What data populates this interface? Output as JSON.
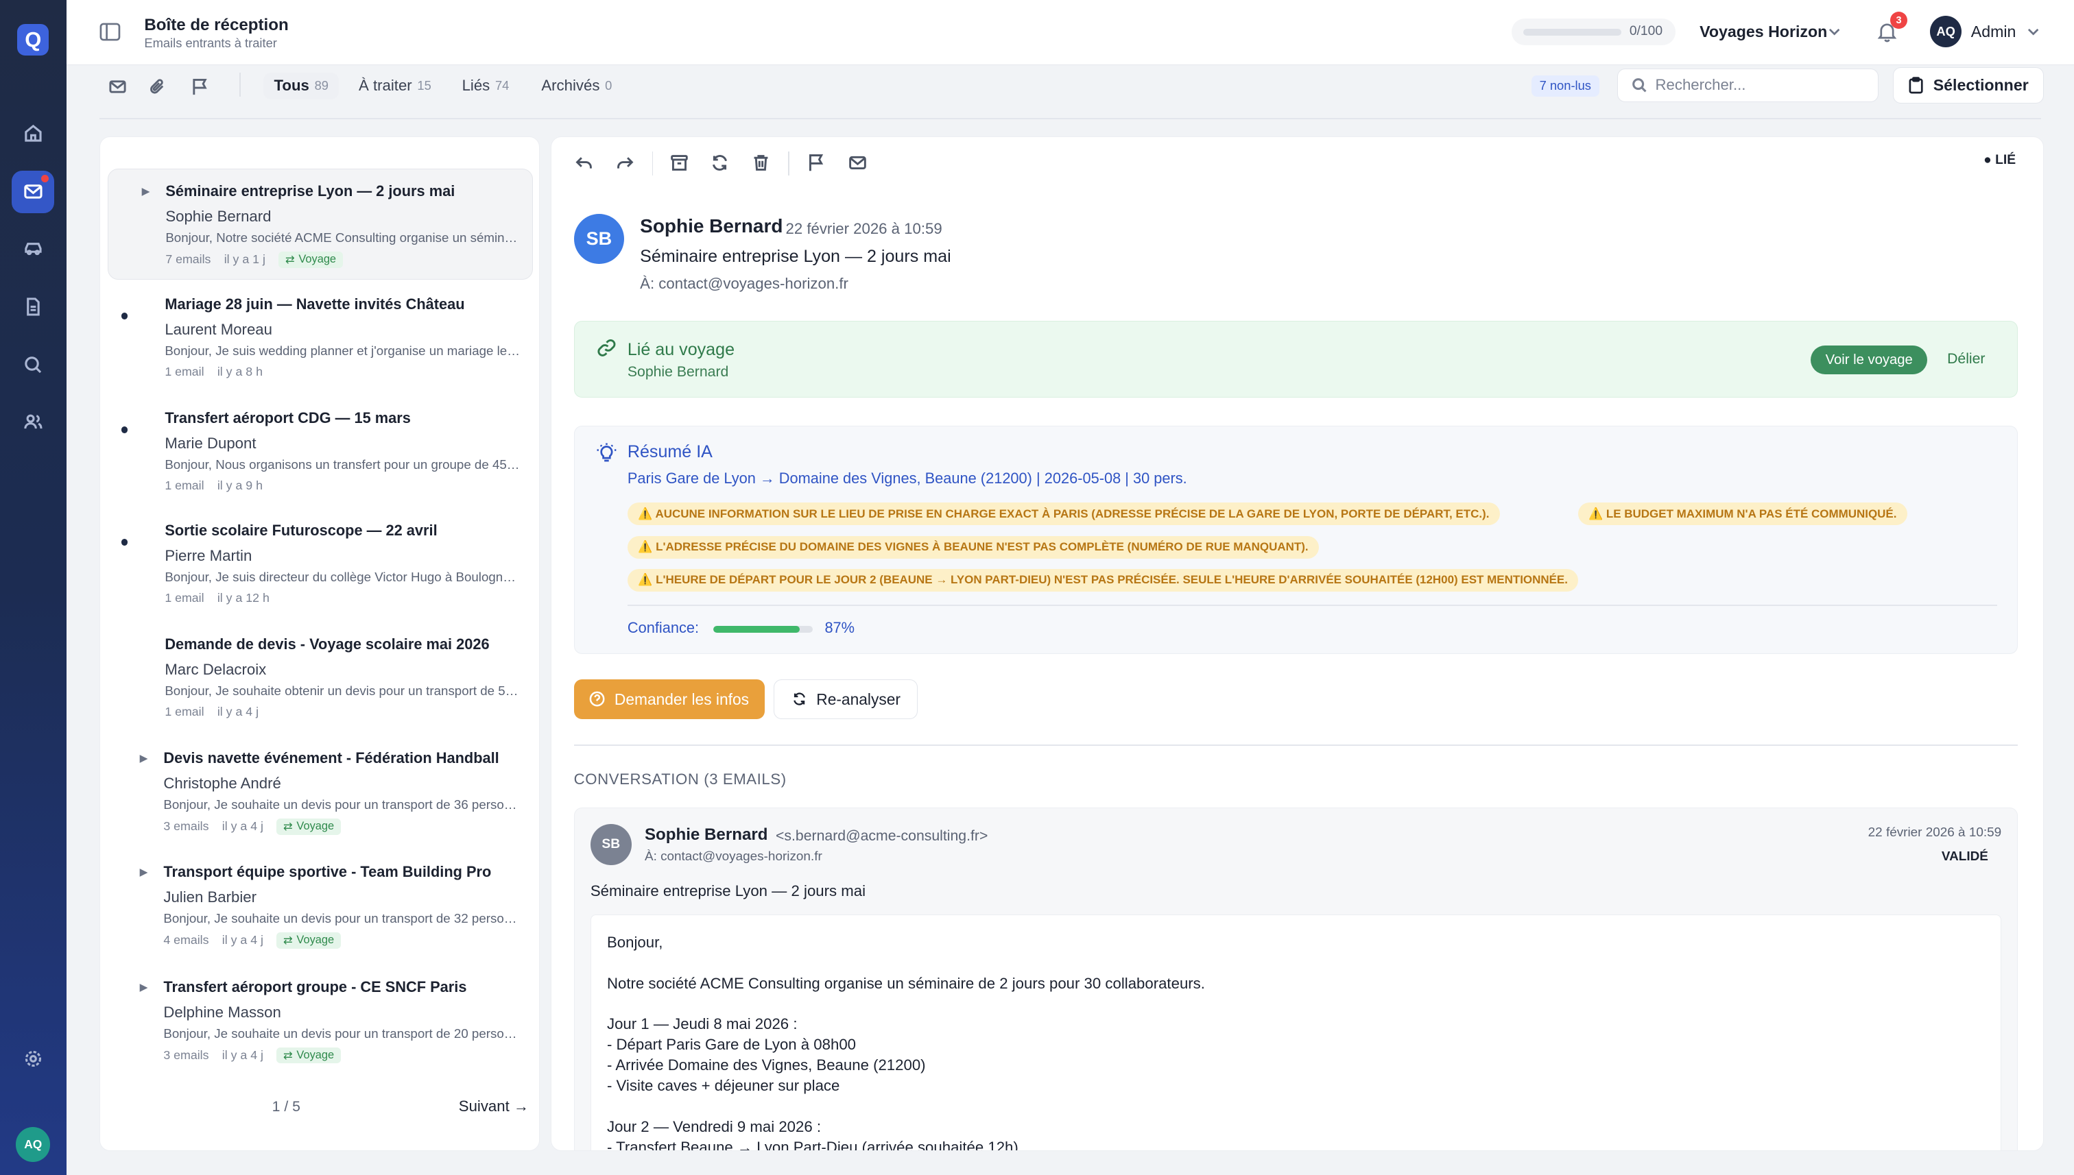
{
  "app": {
    "logo": "Q",
    "header_title": "Boîte de réception",
    "header_subtitle": "Emails entrants à traiter",
    "quota_text": "0/100",
    "company": "Voyages Horizon",
    "notif_count": "3",
    "user_initials": "AQ",
    "user_name": "Admin",
    "sidebar_user_initials": "AQ"
  },
  "filters": {
    "tabs": [
      {
        "label": "Tous",
        "count": "89"
      },
      {
        "label": "À traiter",
        "count": "15"
      },
      {
        "label": "Liés",
        "count": "74"
      },
      {
        "label": "Archivés",
        "count": "0"
      }
    ],
    "unread": "7 non-lus",
    "search_placeholder": "Rechercher...",
    "select_label": "Sélectionner"
  },
  "emails": [
    {
      "subject": "Séminaire entreprise Lyon — 2 jours mai",
      "from": "Sophie Bernard",
      "preview": "Bonjour, Notre société ACME Consulting organise un séminaire de 2 jours pour 30 collaborateurs.",
      "count": "7 emails",
      "time": "il y a 1 j",
      "tag": "Voyage"
    },
    {
      "subject": "Mariage 28 juin — Navette invités Château",
      "from": "Laurent Moreau",
      "preview": "Bonjour, Je suis wedding planner et j'organise un mariage le 28 juin.",
      "count": "1 email",
      "time": "il y a 8 h",
      "tag": ""
    },
    {
      "subject": "Transfert aéroport CDG — 15 mars",
      "from": "Marie Dupont",
      "preview": "Bonjour, Nous organisons un transfert pour un groupe de 45 personnes.",
      "count": "1 email",
      "time": "il y a 9 h",
      "tag": ""
    },
    {
      "subject": "Sortie scolaire Futuroscope — 22 avril",
      "from": "Pierre Martin",
      "preview": "Bonjour, Je suis directeur du collège Victor Hugo à Boulogne-Billancourt.",
      "count": "1 email",
      "time": "il y a 12 h",
      "tag": ""
    },
    {
      "subject": "Demande de devis - Voyage scolaire mai 2026",
      "from": "Marc Delacroix",
      "preview": "Bonjour, Je souhaite obtenir un devis pour un transport de 50 élèves.",
      "count": "1 email",
      "time": "il y a 4 j",
      "tag": ""
    },
    {
      "subject": "Devis navette événement - Fédération Handball",
      "from": "Christophe André",
      "preview": "Bonjour, Je souhaite un devis pour un transport de 36 personnes.",
      "count": "3 emails",
      "time": "il y a 4 j",
      "tag": "Voyage"
    },
    {
      "subject": "Transport équipe sportive - Team Building Pro",
      "from": "Julien Barbier",
      "preview": "Bonjour, Je souhaite un devis pour un transport de 32 personnes.",
      "count": "4 emails",
      "time": "il y a 4 j",
      "tag": "Voyage"
    },
    {
      "subject": "Transfert aéroport groupe - CE SNCF Paris",
      "from": "Delphine Masson",
      "preview": "Bonjour, Je souhaite un devis pour un transport de 20 personnes.",
      "count": "3 emails",
      "time": "il y a 4 j",
      "tag": "Voyage"
    }
  ],
  "pagination": {
    "page": "1 / 5",
    "next": "Suivant →"
  },
  "detail": {
    "status_badge": "● LIÉ",
    "avatar": "SB",
    "sender": "Sophie Bernard",
    "date": "22 février 2026 à 10:59",
    "subject": "Séminaire entreprise Lyon — 2 jours mai",
    "to": "À: contact@voyages-horizon.fr",
    "linked_title": "Lié au voyage",
    "linked_name": "Sophie Bernard",
    "view_trip": "Voir le voyage",
    "unlink": "Délier",
    "summary_title": "Résumé IA",
    "summary_line": "Paris Gare de Lyon → Domaine des Vignes, Beaune (21200) | 2026-05-08 | 30 pers.",
    "warnings": [
      "⚠️ AUCUNE INFORMATION SUR LE LIEU DE PRISE EN CHARGE EXACT À PARIS (ADRESSE PRÉCISE DE LA GARE DE LYON, PORTE DE DÉPART, ETC.).",
      "⚠️ LE BUDGET MAXIMUM N'A PAS ÉTÉ COMMUNIQUÉ.",
      "⚠️ L'ADRESSE PRÉCISE DU DOMAINE DES VIGNES À BEAUNE N'EST PAS COMPLÈTE (NUMÉRO DE RUE MANQUANT).",
      "⚠️ L'HEURE DE DÉPART POUR LE JOUR 2 (BEAUNE → LYON PART-DIEU) N'EST PAS PRÉCISÉE. SEULE L'HEURE D'ARRIVÉE SOUHAITÉE (12H00) EST MENTIONNÉE."
    ],
    "confidence_label": "Confiance:",
    "confidence_value": "87%",
    "confidence": 0.87,
    "ask_btn": "Demander les infos",
    "reanalyze_btn": "Re-analyser",
    "conversation_header": "CONVERSATION (3 EMAILS)"
  },
  "message": {
    "avatar": "SB",
    "from": "Sophie Bernard",
    "email": "<s.bernard@acme-consulting.fr>",
    "to": "À: contact@voyages-horizon.fr",
    "date": "22 février 2026 à 10:59",
    "status": "VALIDÉ",
    "subject": "Séminaire entreprise Lyon — 2 jours mai",
    "body": [
      "Bonjour,",
      "",
      "Notre société ACME Consulting organise un séminaire de 2 jours pour 30 collaborateurs.",
      "",
      "Jour 1 — Jeudi 8 mai 2026 :",
      "- Départ Paris Gare de Lyon à 08h00",
      "- Arrivée Domaine des Vignes, Beaune (21200)",
      "- Visite caves + déjeuner sur place",
      "",
      "Jour 2 — Vendredi 9 mai 2026 :",
      "- Transfert Beaune → Lyon Part-Dieu (arrivée souhaitée 12h)"
    ]
  },
  "colors": {
    "sidebar": "#1f2b45",
    "accent": "#3457c7",
    "linked_bg": "#ebf9ef",
    "warning_bg": "#fdf0c8",
    "ask_button": "#e9a03b"
  }
}
